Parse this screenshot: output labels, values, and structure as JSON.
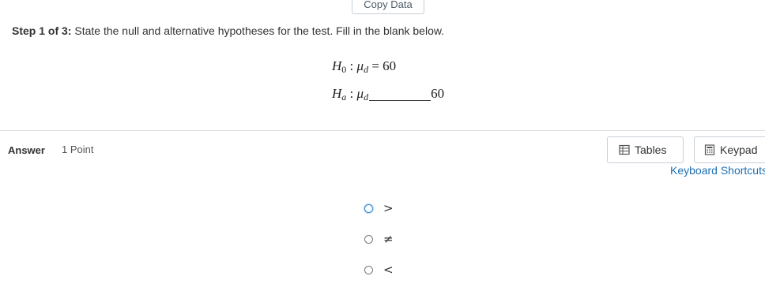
{
  "toolbar": {
    "copy_data_label": "Copy Data"
  },
  "question": {
    "step_label": "Step 1 of 3:",
    "instruction": "State the null and alternative hypotheses for the test. Fill in the blank below.",
    "h0": {
      "symbol": "H",
      "sub": "0",
      "colon": " : ",
      "param": "μ",
      "param_sub": "d",
      "relation": " = ",
      "value": "60"
    },
    "ha": {
      "symbol": "H",
      "sub": "a",
      "colon": " : ",
      "param": "μ",
      "param_sub": "d",
      "value": "60"
    }
  },
  "answer": {
    "label": "Answer",
    "points": "1 Point"
  },
  "tools": {
    "tables_label": "Tables",
    "keypad_label": "Keypad",
    "keyboard_shortcuts_label": "Keyboard Shortcuts"
  },
  "choices": [
    {
      "symbol": ">"
    },
    {
      "symbol": "≠"
    },
    {
      "symbol": "<"
    }
  ],
  "colors": {
    "link": "#1f6fb2",
    "focus": "#3b8ed8",
    "border": "#c8cfd6"
  }
}
